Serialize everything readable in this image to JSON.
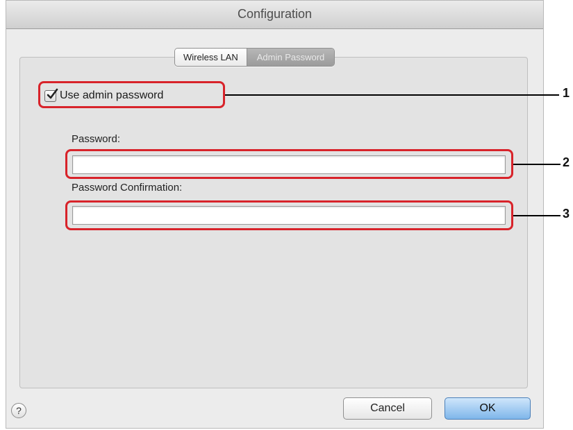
{
  "window": {
    "title": "Configuration"
  },
  "tabs": [
    {
      "label": "Wireless LAN",
      "selected": false
    },
    {
      "label": "Admin Password",
      "selected": true
    }
  ],
  "admin_password": {
    "checkbox_label": "Use admin password",
    "checkbox_checked": true,
    "password_label": "Password:",
    "password_value": "",
    "confirmation_label": "Password Confirmation:",
    "confirmation_value": ""
  },
  "callouts": [
    "1",
    "2",
    "3"
  ],
  "footer": {
    "help_label": "?",
    "cancel_label": "Cancel",
    "ok_label": "OK"
  },
  "colors": {
    "callout_border": "#d8232a",
    "ok_button": "#7fb6ea",
    "active_tab": "#9b9b9b"
  }
}
